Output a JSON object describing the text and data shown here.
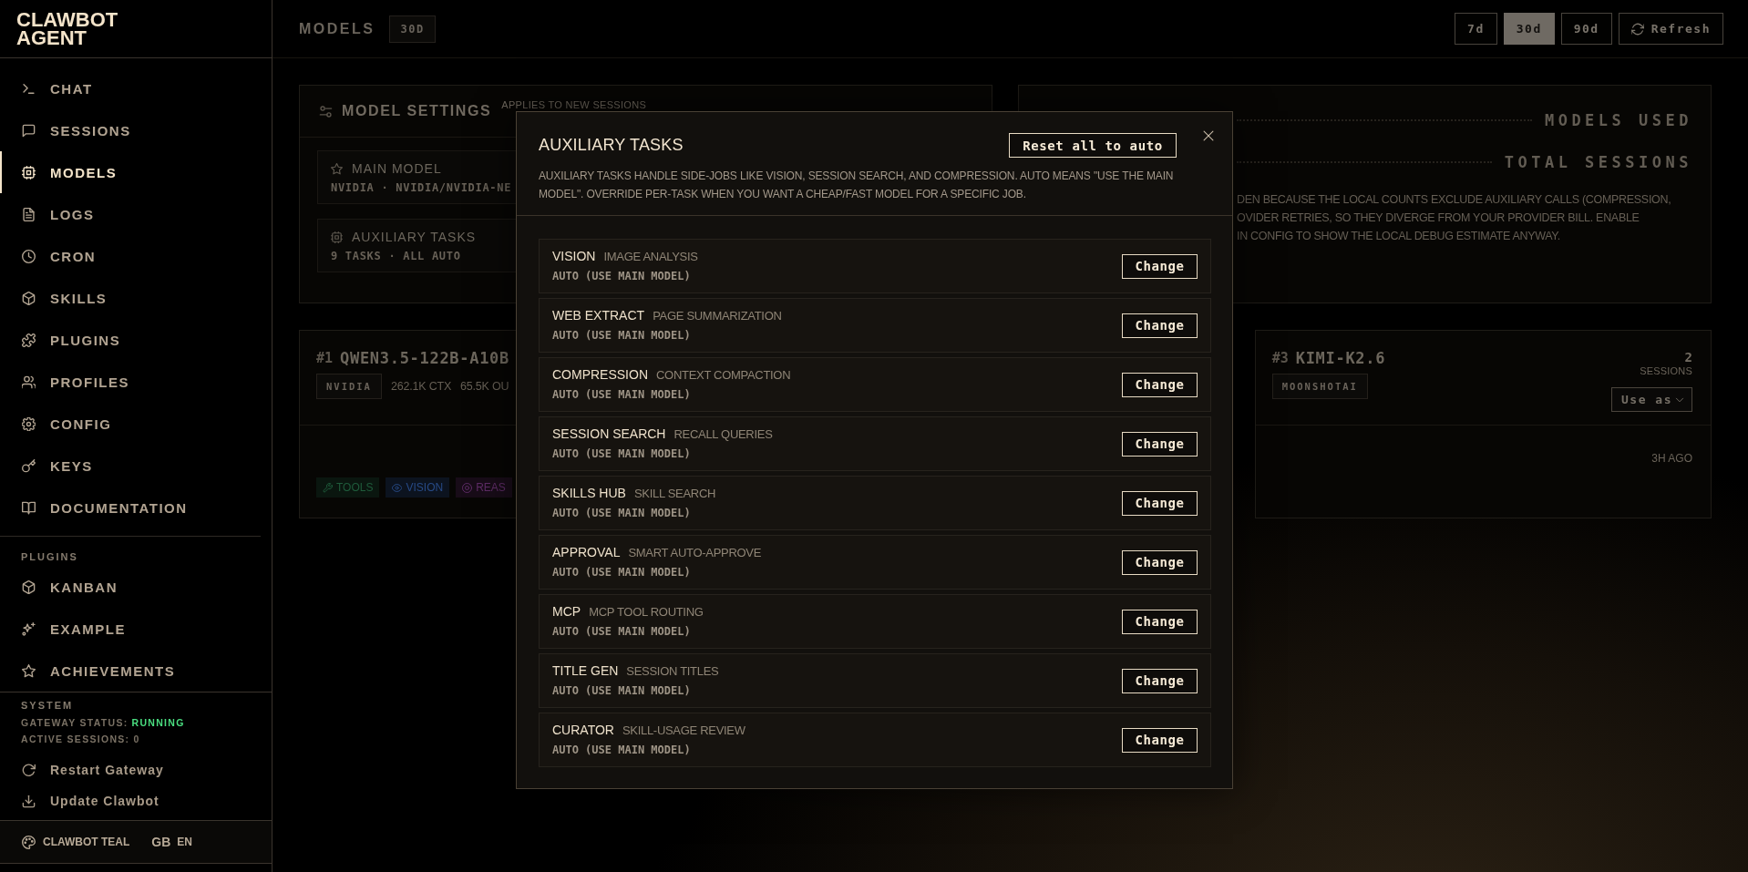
{
  "sidebar": {
    "logo": "CLAWBOT AGENT",
    "nav": [
      {
        "label": "CHAT",
        "selected": false
      },
      {
        "label": "SESSIONS",
        "selected": false
      },
      {
        "label": "MODELS",
        "selected": true
      },
      {
        "label": "LOGS",
        "selected": false
      },
      {
        "label": "CRON",
        "selected": false
      },
      {
        "label": "SKILLS",
        "selected": false
      },
      {
        "label": "PLUGINS",
        "selected": false
      },
      {
        "label": "PROFILES",
        "selected": false
      },
      {
        "label": "CONFIG",
        "selected": false
      },
      {
        "label": "KEYS",
        "selected": false
      },
      {
        "label": "DOCUMENTATION",
        "selected": false
      }
    ],
    "plugins_heading": "PLUGINS",
    "plugins": [
      {
        "label": "KANBAN",
        "selected": false
      },
      {
        "label": "EXAMPLE",
        "selected": false
      },
      {
        "label": "ACHIEVEMENTS",
        "selected": false
      }
    ],
    "system": {
      "heading": "SYSTEM",
      "gateway_label": "GATEWAY STATUS:",
      "gateway_status": "RUNNING",
      "active_sessions": "ACTIVE SESSIONS: 0"
    },
    "actions": [
      "Restart Gateway",
      "Update Clawbot"
    ],
    "theme": "CLAWBOT TEAL",
    "language": {
      "flag": "GB",
      "code": "EN"
    }
  },
  "topbar": {
    "title": "MODELS",
    "badge": "30D",
    "ranges": [
      {
        "label": "7d",
        "selected": false
      },
      {
        "label": "30d",
        "selected": true
      },
      {
        "label": "90d",
        "selected": false
      }
    ],
    "refresh": "Refresh"
  },
  "model_settings": {
    "title": "MODEL SETTINGS",
    "subtitle": "APPLIES TO NEW SESSIONS",
    "tiles": [
      {
        "title": "MAIN MODEL",
        "value": "NVIDIA · NVIDIA/NVIDIA-NE"
      },
      {
        "title": "AUXILIARY TASKS",
        "value": "9 TASKS · ALL AUTO"
      }
    ]
  },
  "summary": {
    "stats": [
      "MODELS USED",
      "TOTAL SESSIONS"
    ],
    "note_lines": [
      "DEN BECAUSE THE LOCAL COUNTS EXCLUDE AUXILIARY CALLS (COMPRESSION,",
      "OVIDER RETRIES, SO THEY DIVERGE FROM YOUR PROVIDER BILL. ENABLE",
      "IN CONFIG TO SHOW THE LOCAL DEBUG ESTIMATE ANYWAY."
    ]
  },
  "model_cards": [
    {
      "rank": "#1",
      "name": "QWEN3.5-122B-A10B",
      "provider": "NVIDIA",
      "specs": [
        "262.1K CTX",
        "65.5K OU"
      ],
      "capabilities": [
        {
          "label": "TOOLS",
          "color": "#1f5b3b"
        },
        {
          "label": "VISION",
          "color": "#274a86"
        },
        {
          "label": "REAS",
          "color": "#5e2c66"
        }
      ]
    },
    {
      "rank": "#3",
      "name": "KIMI-K2.6",
      "provider": "MOONSHOTAI",
      "sessions": "2",
      "sessions_label": "SESSIONS",
      "use_button": "Use as",
      "last_used": "3H AGO"
    }
  ],
  "dialog": {
    "title": "AUXILIARY TASKS",
    "reset_button": "Reset all to auto",
    "description": "AUXILIARY TASKS HANDLE SIDE-JOBS LIKE VISION, SESSION SEARCH, AND COMPRESSION. AUTO MEANS \"USE THE MAIN MODEL\". OVERRIDE PER-TASK WHEN YOU WANT A CHEAP/FAST MODEL FOR A SPECIFIC JOB.",
    "tasks": [
      {
        "name": "VISION",
        "description": "IMAGE ANALYSIS",
        "model": "AUTO (USE MAIN MODEL)",
        "action": "Change"
      },
      {
        "name": "WEB EXTRACT",
        "description": "PAGE SUMMARIZATION",
        "model": "AUTO (USE MAIN MODEL)",
        "action": "Change"
      },
      {
        "name": "COMPRESSION",
        "description": "CONTEXT COMPACTION",
        "model": "AUTO (USE MAIN MODEL)",
        "action": "Change"
      },
      {
        "name": "SESSION SEARCH",
        "description": "RECALL QUERIES",
        "model": "AUTO (USE MAIN MODEL)",
        "action": "Change"
      },
      {
        "name": "SKILLS HUB",
        "description": "SKILL SEARCH",
        "model": "AUTO (USE MAIN MODEL)",
        "action": "Change"
      },
      {
        "name": "APPROVAL",
        "description": "SMART AUTO-APPROVE",
        "model": "AUTO (USE MAIN MODEL)",
        "action": "Change"
      },
      {
        "name": "MCP",
        "description": "MCP TOOL ROUTING",
        "model": "AUTO (USE MAIN MODEL)",
        "action": "Change"
      },
      {
        "name": "TITLE GEN",
        "description": "SESSION TITLES",
        "model": "AUTO (USE MAIN MODEL)",
        "action": "Change"
      },
      {
        "name": "CURATOR",
        "description": "SKILL-USAGE REVIEW",
        "model": "AUTO (USE MAIN MODEL)",
        "action": "Change"
      }
    ]
  }
}
